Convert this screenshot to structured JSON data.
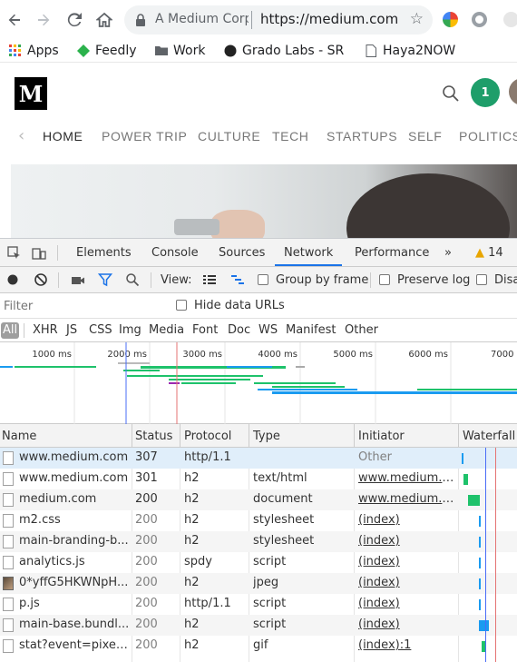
{
  "browser": {
    "tab_site": "A Medium Corpo",
    "url": "https://medium.com",
    "bookmarks": [
      "Apps",
      "Feedly",
      "Work",
      "Grado Labs - SR",
      "Haya2NOW"
    ]
  },
  "medium": {
    "logo": "M",
    "avatar_initial": "1",
    "nav": [
      "HOME",
      "POWER TRIP",
      "CULTURE",
      "TECH",
      "STARTUPS",
      "SELF",
      "POLITICS"
    ],
    "nav_active": "HOME"
  },
  "devtools": {
    "tabs": [
      "Elements",
      "Console",
      "Sources",
      "Network",
      "Performance",
      "»"
    ],
    "active_tab": "Network",
    "warning_count": "14",
    "controls": {
      "view_label": "View:",
      "group_by_frame": "Group by frame",
      "preserve_log": "Preserve log",
      "disable_cache": "Disa"
    },
    "filter": {
      "placeholder": "Filter",
      "hide_data_urls": "Hide data URLs"
    },
    "type_filters": [
      "All",
      "XHR",
      "JS",
      "CSS",
      "Img",
      "Media",
      "Font",
      "Doc",
      "WS",
      "Manifest",
      "Other"
    ],
    "overview": {
      "ticks": [
        "1000 ms",
        "2000 ms",
        "3000 ms",
        "4000 ms",
        "5000 ms",
        "6000 ms",
        "7000"
      ]
    },
    "columns": [
      "Name",
      "Status",
      "Protocol",
      "Type",
      "Initiator",
      "Waterfall"
    ],
    "rows": [
      {
        "name": "www.medium.com",
        "status": "307",
        "protocol": "http/1.1",
        "type": "",
        "initiator": "Other"
      },
      {
        "name": "www.medium.com",
        "status": "301",
        "protocol": "h2",
        "type": "text/html",
        "initiator": "www.medium.c..."
      },
      {
        "name": "medium.com",
        "status": "200",
        "protocol": "h2",
        "type": "document",
        "initiator": "www.medium.c..."
      },
      {
        "name": "m2.css",
        "status": "200",
        "protocol": "h2",
        "type": "stylesheet",
        "initiator": "(index)"
      },
      {
        "name": "main-branding-b...",
        "status": "200",
        "protocol": "h2",
        "type": "stylesheet",
        "initiator": "(index)"
      },
      {
        "name": "analytics.js",
        "status": "200",
        "protocol": "spdy",
        "type": "script",
        "initiator": "(index)"
      },
      {
        "name": "0*yffG5HKWNpH...",
        "status": "200",
        "protocol": "h2",
        "type": "jpeg",
        "initiator": "(index)"
      },
      {
        "name": "p.js",
        "status": "200",
        "protocol": "http/1.1",
        "type": "script",
        "initiator": "(index)"
      },
      {
        "name": "main-base.bundl...",
        "status": "200",
        "protocol": "h2",
        "type": "script",
        "initiator": "(index)"
      },
      {
        "name": "stat?event=pixel....",
        "status": "200",
        "protocol": "h2",
        "type": "gif",
        "initiator": "(index):1"
      }
    ]
  },
  "colors": {
    "accent_blue": "#1a73e8",
    "medium_green": "#1e9e6a",
    "wf_green": "#1ec26b",
    "wf_blue": "#1a9bf0",
    "warning": "#e8a500"
  }
}
